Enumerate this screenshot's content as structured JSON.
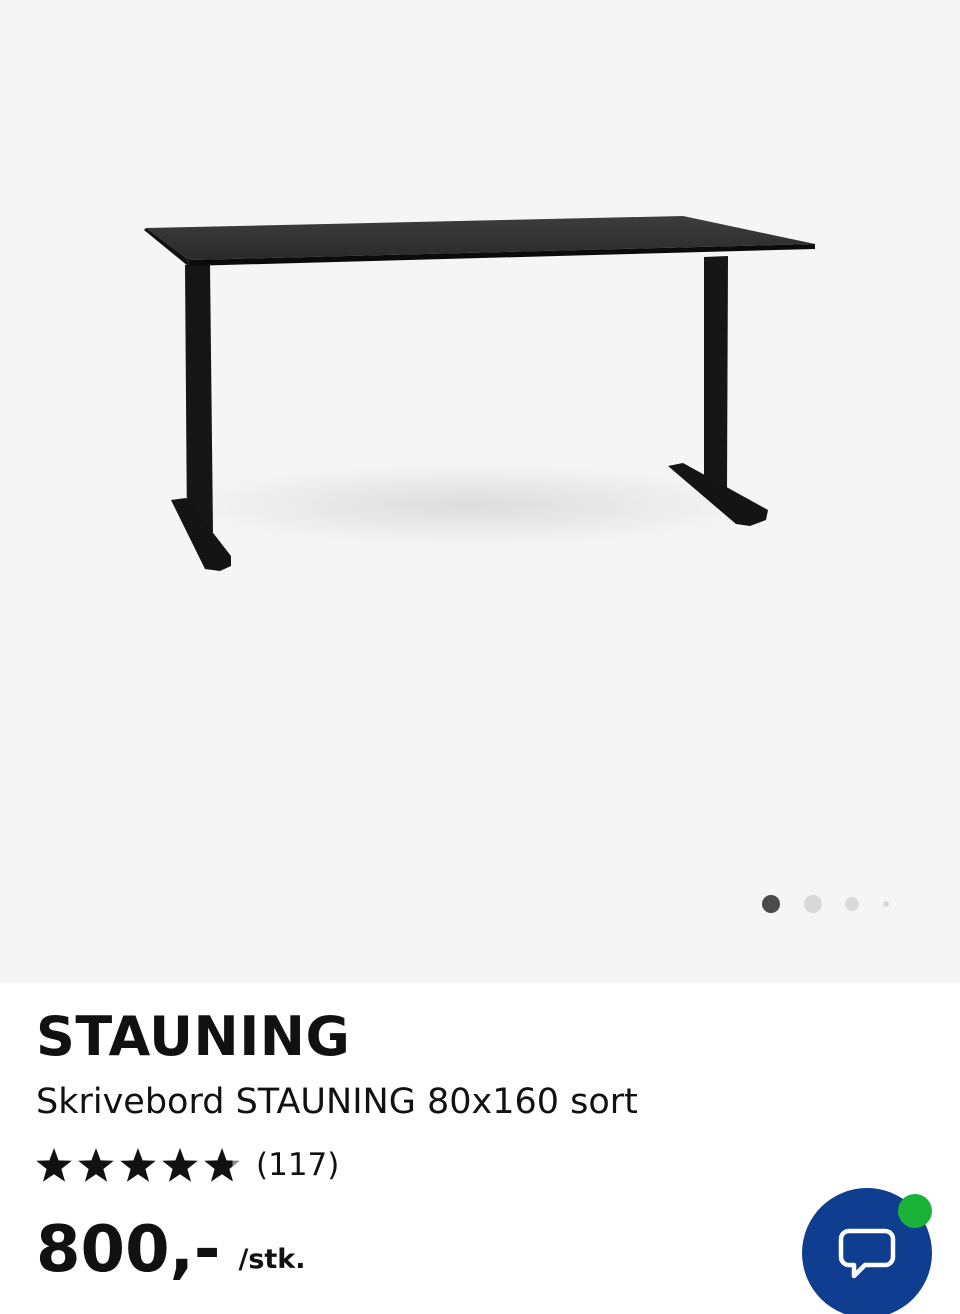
{
  "product": {
    "name": "STAUNING",
    "description": "Skrivebord STAUNING 80x160 sort",
    "rating": {
      "stars": 4.8,
      "max_stars": 5,
      "review_count": "(117)"
    },
    "price": {
      "amount": "800,-",
      "unit": "/stk."
    }
  },
  "gallery": {
    "image_count": 4,
    "active_index": 0,
    "image_icon": "desk-image"
  },
  "chat": {
    "icon": "chat-bubble-icon",
    "online": true
  },
  "colors": {
    "gallery_background": "#f5f5f5",
    "chat_button": "#0f3e91",
    "online_indicator": "#1ab337",
    "active_dot": "#4a4a4a",
    "inactive_dot": "#d9d9d9",
    "text": "#111111"
  }
}
